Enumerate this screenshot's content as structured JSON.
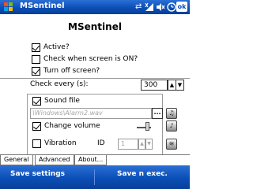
{
  "app": {
    "title": "MSentinel",
    "heading": "MSentinel",
    "ok_label": "ok",
    "icons": {
      "start": "windows-start-icon",
      "connectivity": "connectivity-icon",
      "signal": "signal-icon",
      "volume": "volume-mute-icon",
      "time": "clock-icon"
    }
  },
  "options": {
    "active": {
      "label": "Active?",
      "checked": true
    },
    "check_screen_on": {
      "label": "Check when screen is ON?",
      "checked": false
    },
    "turn_off_screen": {
      "label": "Turn off screen?",
      "checked": true
    }
  },
  "check_every": {
    "label": "Check every (s):",
    "value": "300"
  },
  "sound": {
    "sound_file": {
      "label": "Sound file",
      "checked": true
    },
    "file_path": "\\Windows\\Alarm2.wav",
    "browse_label": "...",
    "change_volume": {
      "label": "Change volume",
      "checked": true
    },
    "vibration": {
      "label": "Vibration",
      "checked": false
    },
    "id_label": "ID",
    "id_value": "1"
  },
  "tabs": [
    {
      "label": "General",
      "active": true
    },
    {
      "label": "Advanced",
      "active": false
    },
    {
      "label": "About...",
      "active": false
    }
  ],
  "menu": {
    "left": "Save settings",
    "right": "Save n exec."
  },
  "colors": {
    "titlebar": "#0b4fb6",
    "menubar": "#0b4fb6"
  }
}
